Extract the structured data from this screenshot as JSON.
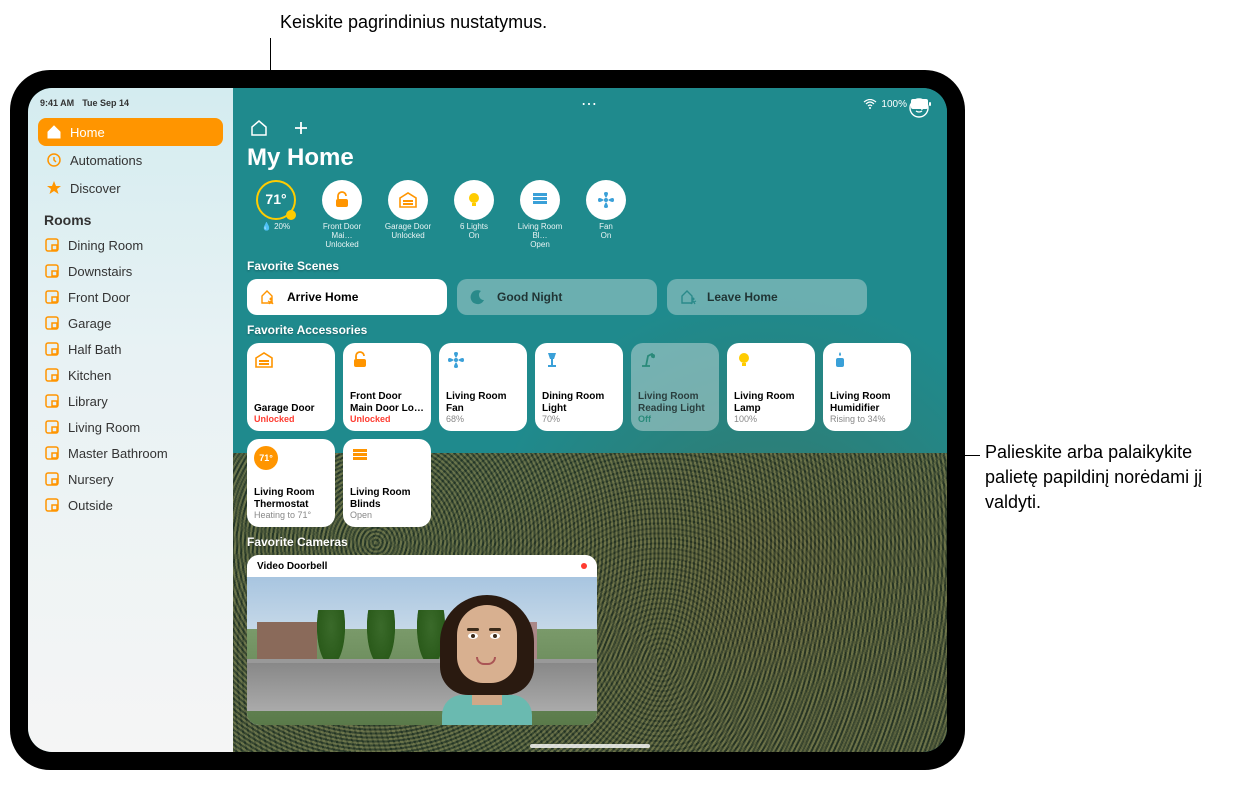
{
  "callouts": {
    "top": "Keiskite pagrindinius nustatymus.",
    "right": "Palieskite arba palaikykite palietę papildinį norėdami jį valdyti."
  },
  "status_bar": {
    "time": "9:41 AM",
    "date": "Tue Sep 14",
    "battery": "100%"
  },
  "sidebar": {
    "nav": [
      {
        "label": "Home",
        "icon": "house-icon",
        "selected": true
      },
      {
        "label": "Automations",
        "icon": "clock-icon",
        "selected": false
      },
      {
        "label": "Discover",
        "icon": "star-icon",
        "selected": false
      }
    ],
    "rooms_heading": "Rooms",
    "rooms": [
      "Dining Room",
      "Downstairs",
      "Front Door",
      "Garage",
      "Half Bath",
      "Kitchen",
      "Library",
      "Living Room",
      "Master Bathroom",
      "Nursery",
      "Outside"
    ]
  },
  "main": {
    "title": "My Home",
    "weather": {
      "temp": "71°",
      "humidity_pct": "20%"
    },
    "status_circles": [
      {
        "line1": "Front Door Mai…",
        "line2": "Unlocked",
        "icon": "lock-open-icon"
      },
      {
        "line1": "Garage Door",
        "line2": "Unlocked",
        "icon": "garage-icon"
      },
      {
        "line1": "6 Lights",
        "line2": "On",
        "icon": "bulb-icon"
      },
      {
        "line1": "Living Room Bl…",
        "line2": "Open",
        "icon": "blinds-icon"
      },
      {
        "line1": "Fan",
        "line2": "On",
        "icon": "fan-icon"
      }
    ],
    "scenes_heading": "Favorite Scenes",
    "scenes": [
      {
        "label": "Arrive Home",
        "icon": "person-arrive-icon",
        "active": true,
        "color": "#ff9500"
      },
      {
        "label": "Good Night",
        "icon": "moon-icon",
        "active": false,
        "color": "#2a8a8a"
      },
      {
        "label": "Leave Home",
        "icon": "person-leave-icon",
        "active": false,
        "color": "#2a8a8a"
      }
    ],
    "accessories_heading": "Favorite Accessories",
    "accessories": [
      {
        "name": "Garage Door",
        "status": "Unlocked",
        "status_class": "unlocked",
        "icon": "garage-icon",
        "on": true,
        "color": "#ff9500"
      },
      {
        "name": "Front Door Main Door Lo…",
        "status": "Unlocked",
        "status_class": "unlocked",
        "icon": "lock-open-icon",
        "on": true,
        "color": "#ff9500"
      },
      {
        "name": "Living Room Fan",
        "status": "68%",
        "status_class": "dim",
        "icon": "fan-icon",
        "on": true,
        "color": "#3aa0d8"
      },
      {
        "name": "Dining Room Light",
        "status": "70%",
        "status_class": "dim",
        "icon": "lamp-icon",
        "on": true,
        "color": "#3aa0d8"
      },
      {
        "name": "Living Room Reading Light",
        "status": "Off",
        "status_class": "off-green",
        "icon": "desk-lamp-icon",
        "on": false,
        "color": "#2a8a7a"
      },
      {
        "name": "Living Room Lamp",
        "status": "100%",
        "status_class": "dim",
        "icon": "bulb-icon",
        "on": true,
        "color": "#ffcc00"
      },
      {
        "name": "Living Room Humidifier",
        "status": "Rising to 34%",
        "status_class": "dim",
        "icon": "humidifier-icon",
        "on": true,
        "color": "#3aa0d8"
      },
      {
        "name": "Living Room Thermostat",
        "status": "Heating to 71°",
        "status_class": "dim",
        "icon": "thermostat-icon",
        "on": true,
        "color": "#ff9500",
        "badge": "71°"
      },
      {
        "name": "Living Room Blinds",
        "status": "Open",
        "status_class": "dim",
        "icon": "blinds-icon",
        "on": true,
        "color": "#ff9500"
      }
    ],
    "cameras_heading": "Favorite Cameras",
    "camera": {
      "title": "Video Doorbell"
    }
  },
  "icons": {
    "more": "⋯",
    "wifi": "wifi",
    "battery": "battery"
  }
}
